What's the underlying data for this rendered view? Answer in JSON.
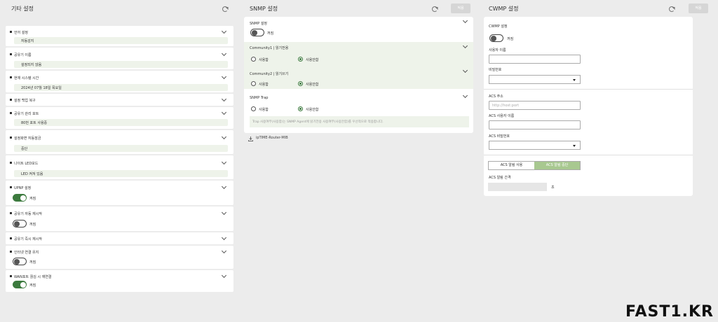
{
  "left": {
    "title": "기타 설정",
    "cards": [
      {
        "title": "언어 설정",
        "value": "자동감지"
      },
      {
        "title": "공유기 이름",
        "value": "설정되지 않음"
      },
      {
        "title": "현재 시스템 시간",
        "value": "2024년 07월 18일 목요일"
      },
      {
        "title": "설정 백업 복구"
      },
      {
        "title": "공유기 관리 포트",
        "value": "80번 포트 사용중"
      },
      {
        "title": "설정화면 자동잠금",
        "value": "중단"
      },
      {
        "title": "나이트 LED모드",
        "value": "LED 켜져 있음"
      },
      {
        "title": "UPNP 설정",
        "toggle": "on",
        "toggle_label": "켜짐"
      },
      {
        "title": "공유기 자동 재시작",
        "toggle": "off",
        "toggle_label": "꺼짐"
      },
      {
        "title": "공유기 즉시 재시작"
      },
      {
        "title": "인터넷 연결 유지",
        "toggle": "off",
        "toggle_label": "꺼짐"
      },
      {
        "title": "WAN포트 끊김 시 재연결",
        "toggle": "on",
        "toggle_label": "켜짐"
      }
    ]
  },
  "snmp": {
    "title": "SNMP 설정",
    "apply": "적용",
    "setting_title": "SNMP 설정",
    "setting_toggle": "꺼짐",
    "community1_title": "Community1 | 읽기전용",
    "community2_title": "Community2 | 읽기쓰기",
    "trap_title": "SNMP Trap",
    "use_label": "사용함",
    "nouse_label": "사용안함",
    "trap_note": "Trap 사용여부(사용함)는 SNMP Agent에 읽기전용 사용여부(사용안함)를 우선적으로 적용합니다.",
    "mib": "ipTIME-Router-MIB"
  },
  "cwmp": {
    "title": "CWMP 설정",
    "apply": "적용",
    "setting_label": "CWMP 설정",
    "toggle_label": "꺼짐",
    "username_label": "사용자 이름",
    "password_label": "비밀번호",
    "acs_addr_label": "ACS 주소",
    "acs_addr_placeholder": "http://host:port",
    "acs_user_label": "ACS 사용자 이름",
    "acs_pass_label": "ACS 비밀번호",
    "tab_use": "ACS 알림 사용",
    "tab_nouse": "ACS 알림 중단",
    "interval_label": "ACS 알림 간격",
    "interval_unit": "초",
    "colors": {
      "accent": "#a8c890",
      "toggle_on": "#3c7a3e"
    }
  },
  "watermark": "FAST1.KR"
}
